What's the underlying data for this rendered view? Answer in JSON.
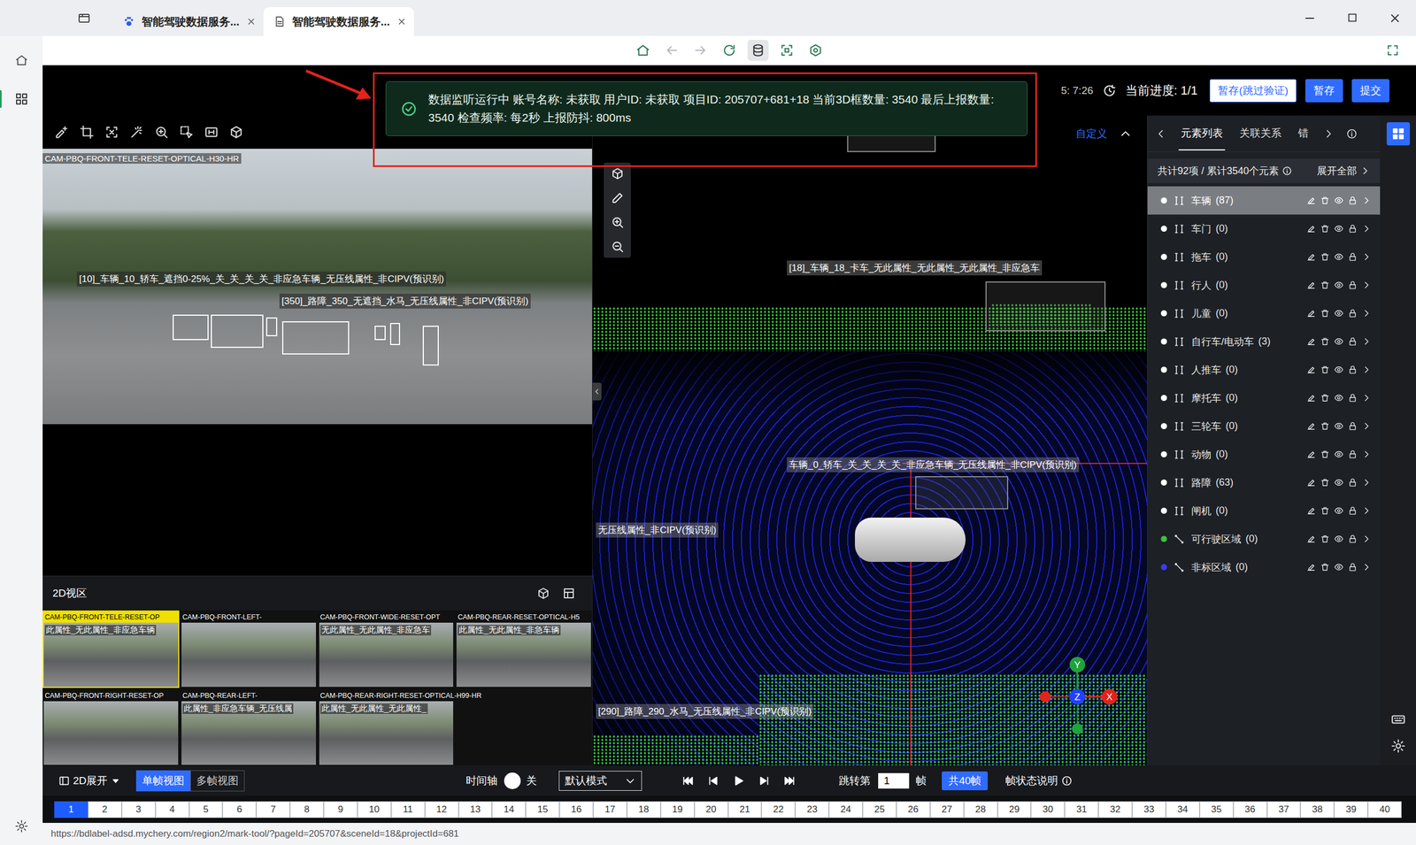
{
  "browser": {
    "tabs": [
      {
        "label": "智能驾驶数据服务...",
        "selected": false
      },
      {
        "label": "智能驾驶数据服务...",
        "selected": true
      }
    ],
    "sidebar": [
      {
        "selected": false
      },
      {
        "selected": true
      }
    ],
    "toolbar": [
      {
        "disabled": false,
        "selected": false
      },
      {
        "disabled": true,
        "selected": false
      },
      {
        "disabled": true,
        "selected": false
      },
      {
        "disabled": false,
        "selected": false
      },
      {
        "disabled": false,
        "selected": true
      },
      {
        "disabled": false,
        "selected": false
      },
      {
        "disabled": false,
        "selected": false
      }
    ],
    "status_url": "https://bdlabel-adsd.mychery.com/region2/mark-tool/?pageId=205707&sceneId=18&projectId=681"
  },
  "header": {
    "time": "5: 7:26",
    "progress_label": "当前进度: 1/1",
    "buttons": [
      {
        "label": "暂存(跳过验证)",
        "kind": "outline"
      },
      {
        "label": "暂存",
        "kind": "primary"
      },
      {
        "label": "提交",
        "kind": "primary"
      }
    ]
  },
  "toast": {
    "text": "数据监听运行中 账号名称: 未获取 用户ID: 未获取 项目ID: 205707+681+18 当前3D框数量: 3540 最后上报数量: 3540 检查频率: 每2秒 上报防抖: 800ms"
  },
  "left_panel": {
    "camera": "CAM-PBQ-FRONT-TELE-RESET-OPTICAL-H30-HR",
    "annotations": [
      "[10]_车辆_10_轿车_遮挡0-25%_关_关_关_关_非应急车辆_无压线属性_非CIPV(预识别)",
      "[350]_路障_350_无遮挡_水马_无压线属性_非CIPV(预识别)"
    ],
    "section_title": "2D视区",
    "thumbnails": [
      {
        "label": "CAM-PBQ-FRONT-TELE-RESET-OP",
        "caption": "此属性_无此属性_非应急车辆",
        "selected": true
      },
      {
        "label": "CAM-PBQ-FRONT-LEFT-",
        "caption": "",
        "selected": false
      },
      {
        "label": "CAM-PBQ-FRONT-WIDE-RESET-OPT",
        "caption": "无此属性_无此属性_非应急车",
        "selected": false
      },
      {
        "label": "CAM-PBQ-REAR-RESET-OPTICAL-H5",
        "caption": "此属性_无此属性_非急车辆",
        "selected": false
      },
      {
        "label": "CAM-PBQ-FRONT-RIGHT-RESET-OP",
        "caption": "",
        "selected": false
      },
      {
        "label": "CAM-PBQ-REAR-LEFT-",
        "caption": "此属性_非应急车辆_无压线属",
        "selected": false
      },
      {
        "label": "CAM-PBQ-REAR-RIGHT-RESET-OPTICAL-H99-HR",
        "caption": "此属性_无此属性_无此属性_",
        "selected": false
      }
    ]
  },
  "view3d": {
    "custom_label": "自定义",
    "labels": [
      "[18]_车辆_18_卡车_无此属性_无此属性_无此属性_非应急车",
      "车辆_0_轿车_关_关_关_关_非应急车辆_无压线属性_非CIPV(预识别)",
      "无压线属性_非CIPV(预识别)",
      "[290]_路障_290_水马_无压线属性_非CIPV(预识别)"
    ],
    "axes": [
      {
        "label": "Y",
        "color": "#1fa33b"
      },
      {
        "label": "Z",
        "color": "#2340ff"
      },
      {
        "label": "X",
        "color": "#e3221c"
      }
    ]
  },
  "elements": {
    "tabs": [
      {
        "label": "元素列表",
        "selected": true
      },
      {
        "label": "关联关系",
        "selected": false
      },
      {
        "label": "错",
        "selected": false
      }
    ],
    "summary": "共计92项 / 累计3540个元素",
    "expand_all": "展开全部",
    "items": [
      {
        "label": "车辆",
        "count": "(87)",
        "selected": true,
        "color": "#ffffff",
        "kind": "box"
      },
      {
        "label": "车门",
        "count": "(0)",
        "selected": false,
        "color": "#ffffff",
        "kind": "box"
      },
      {
        "label": "拖车",
        "count": "(0)",
        "selected": false,
        "color": "#ffffff",
        "kind": "box"
      },
      {
        "label": "行人",
        "count": "(0)",
        "selected": false,
        "color": "#ffffff",
        "kind": "box"
      },
      {
        "label": "儿童",
        "count": "(0)",
        "selected": false,
        "color": "#ffffff",
        "kind": "box"
      },
      {
        "label": "自行车/电动车",
        "count": "(3)",
        "selected": false,
        "color": "#ffffff",
        "kind": "box"
      },
      {
        "label": "人推车",
        "count": "(0)",
        "selected": false,
        "color": "#ffffff",
        "kind": "box"
      },
      {
        "label": "摩托车",
        "count": "(0)",
        "selected": false,
        "color": "#ffffff",
        "kind": "box"
      },
      {
        "label": "三轮车",
        "count": "(0)",
        "selected": false,
        "color": "#ffffff",
        "kind": "box"
      },
      {
        "label": "动物",
        "count": "(0)",
        "selected": false,
        "color": "#ffffff",
        "kind": "box"
      },
      {
        "label": "路障",
        "count": "(63)",
        "selected": false,
        "color": "#ffffff",
        "kind": "box"
      },
      {
        "label": "闸机",
        "count": "(0)",
        "selected": false,
        "color": "#ffffff",
        "kind": "box"
      },
      {
        "label": "可行驶区域",
        "count": "(0)",
        "selected": false,
        "color": "#3fbf3f",
        "kind": "line"
      },
      {
        "label": "非标区域",
        "count": "(0)",
        "selected": false,
        "color": "#3a3aff",
        "kind": "line"
      }
    ]
  },
  "controls": {
    "expand_label": "2D展开",
    "view_modes": [
      {
        "label": "单帧视图",
        "selected": true
      },
      {
        "label": "多帧视图",
        "selected": false
      }
    ],
    "timeline_label": "时间轴",
    "timeline_on": false,
    "timeline_state": "关",
    "mode": "默认模式",
    "jump_label": "跳转第",
    "jump_value": "1",
    "frame_unit": "帧",
    "total": "共40帧",
    "legend": "帧状态说明"
  },
  "frames": [
    {
      "label": "1",
      "selected": true
    },
    {
      "label": "2",
      "selected": false
    },
    {
      "label": "3",
      "selected": false
    },
    {
      "label": "4",
      "selected": false
    },
    {
      "label": "5",
      "selected": false
    },
    {
      "label": "6",
      "selected": false
    },
    {
      "label": "7",
      "selected": false
    },
    {
      "label": "8",
      "selected": false
    },
    {
      "label": "9",
      "selected": false
    },
    {
      "label": "10",
      "selected": false
    },
    {
      "label": "11",
      "selected": false
    },
    {
      "label": "12",
      "selected": false
    },
    {
      "label": "13",
      "selected": false
    },
    {
      "label": "14",
      "selected": false
    },
    {
      "label": "15",
      "selected": false
    },
    {
      "label": "16",
      "selected": false
    },
    {
      "label": "17",
      "selected": false
    },
    {
      "label": "18",
      "selected": false
    },
    {
      "label": "19",
      "selected": false
    },
    {
      "label": "20",
      "selected": false
    },
    {
      "label": "21",
      "selected": false
    },
    {
      "label": "22",
      "selected": false
    },
    {
      "label": "23",
      "selected": false
    },
    {
      "label": "24",
      "selected": false
    },
    {
      "label": "25",
      "selected": false
    },
    {
      "label": "26",
      "selected": false
    },
    {
      "label": "27",
      "selected": false
    },
    {
      "label": "28",
      "selected": false
    },
    {
      "label": "29",
      "selected": false
    },
    {
      "label": "30",
      "selected": false
    },
    {
      "label": "31",
      "selected": false
    },
    {
      "label": "32",
      "selected": false
    },
    {
      "label": "33",
      "selected": false
    },
    {
      "label": "34",
      "selected": false
    },
    {
      "label": "35",
      "selected": false
    },
    {
      "label": "36",
      "selected": false
    },
    {
      "label": "37",
      "selected": false
    },
    {
      "label": "38",
      "selected": false
    },
    {
      "label": "39",
      "selected": false
    },
    {
      "label": "40",
      "selected": false
    }
  ]
}
